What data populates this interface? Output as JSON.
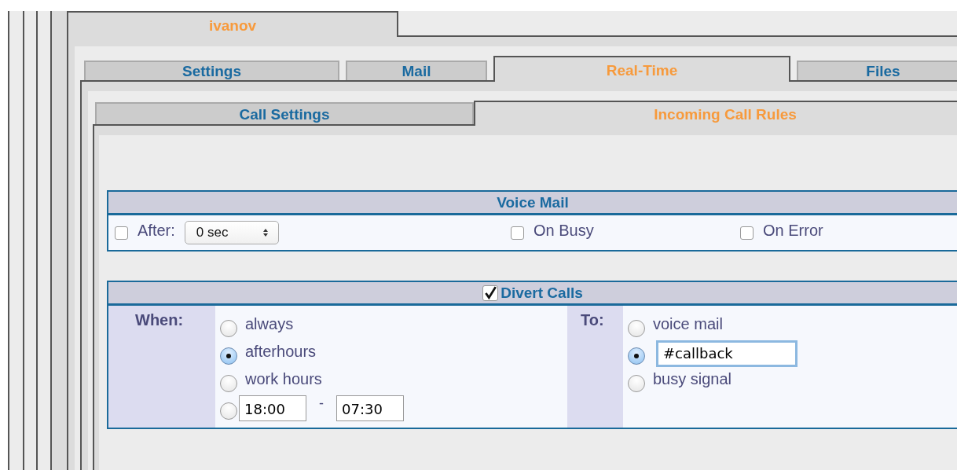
{
  "account_tab": {
    "label": "ivanov",
    "selected": true
  },
  "tabs": [
    {
      "label": "Settings",
      "selected": false
    },
    {
      "label": "Mail",
      "selected": false
    },
    {
      "label": "Real-Time",
      "selected": true
    },
    {
      "label": "Files",
      "selected": false
    }
  ],
  "subtabs": [
    {
      "label": "Call Settings",
      "selected": false
    },
    {
      "label": "Incoming Call Rules",
      "selected": true
    }
  ],
  "voice_mail": {
    "title": "Voice Mail",
    "after": {
      "label": "After:",
      "checked": false,
      "value": "0 sec"
    },
    "on_busy": {
      "label": "On Busy",
      "checked": false
    },
    "on_error": {
      "label": "On Error",
      "checked": false
    }
  },
  "divert": {
    "title": "Divert Calls",
    "checked": true,
    "when_label": "When:",
    "to_label": "To:",
    "when_options": [
      {
        "kind": "label",
        "label": "always",
        "selected": false
      },
      {
        "kind": "label",
        "label": "afterhours",
        "selected": true
      },
      {
        "kind": "label",
        "label": "work hours",
        "selected": false
      },
      {
        "kind": "range",
        "from": "18:00",
        "separator": "-",
        "to": "07:30",
        "selected": false
      }
    ],
    "to_options": [
      {
        "kind": "label",
        "label": "voice mail",
        "selected": false
      },
      {
        "kind": "field",
        "value": "#callback",
        "selected": true
      },
      {
        "kind": "label",
        "label": "busy signal",
        "selected": false
      }
    ]
  }
}
